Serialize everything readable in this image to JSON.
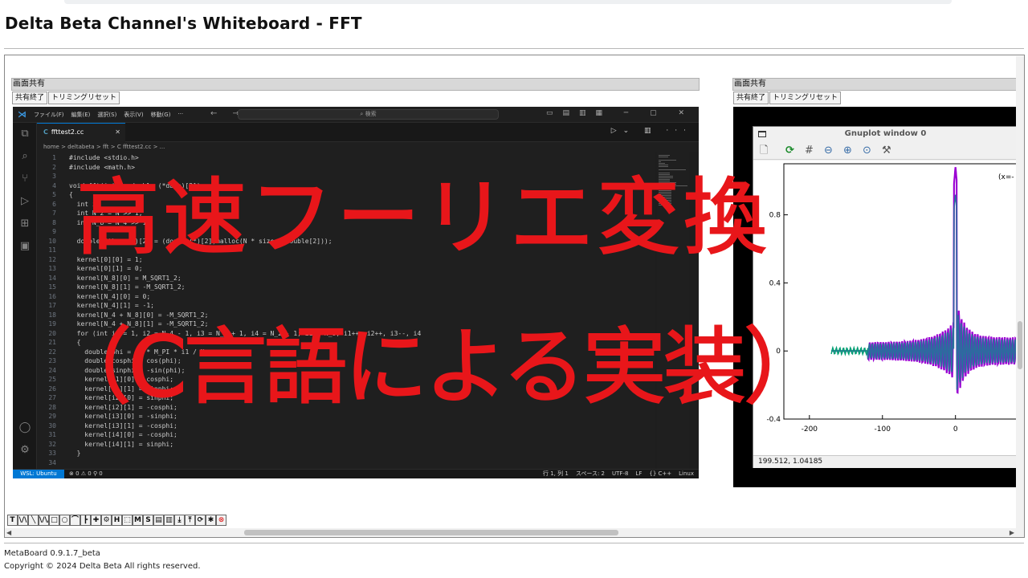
{
  "page": {
    "title": "Delta Beta Channel's Whiteboard - FFT"
  },
  "left_panel": {
    "header": "画面共有",
    "buttons": [
      "共有終了",
      "トリミングリセット"
    ]
  },
  "right_panel": {
    "header": "画面共有",
    "buttons": [
      "共有終了",
      "トリミングリセット"
    ]
  },
  "vscode": {
    "menu": [
      "ファイル(F)",
      "編集(E)",
      "選択(S)",
      "表示(V)",
      "移動(G)",
      "···"
    ],
    "nav": "← →",
    "search": "⌕ 検索",
    "tab": "ffttest2.cc",
    "tab_icon": "C",
    "breadcrumb": "home > deltabeta > fft > C ffttest2.cc > ...",
    "code_lines": [
      {
        "n": "1",
        "t": "#include <stdio.h>"
      },
      {
        "n": "2",
        "t": "#include <math.h>"
      },
      {
        "n": "3",
        "t": ""
      },
      {
        "n": "4",
        "t": "void fft(int N, double (*data)[2])"
      },
      {
        "n": "5",
        "t": "{"
      },
      {
        "n": "6",
        "t": "  int i;"
      },
      {
        "n": "7",
        "t": "  int N_2 = N >> 1;"
      },
      {
        "n": "8",
        "t": "  int N_8 = N_4 >> 1;"
      },
      {
        "n": "9",
        "t": ""
      },
      {
        "n": "10",
        "t": "  double (*kernel)[2] = (double(*)[2])malloc(N * sizeof(double[2]));"
      },
      {
        "n": "11",
        "t": ""
      },
      {
        "n": "12",
        "t": "  kernel[0][0] = 1;"
      },
      {
        "n": "13",
        "t": "  kernel[0][1] = 0;"
      },
      {
        "n": "14",
        "t": "  kernel[N_8][0] = M_SQRT1_2;"
      },
      {
        "n": "15",
        "t": "  kernel[N_8][1] = -M_SQRT1_2;"
      },
      {
        "n": "16",
        "t": "  kernel[N_4][0] = 0;"
      },
      {
        "n": "17",
        "t": "  kernel[N_4][1] = -1;"
      },
      {
        "n": "18",
        "t": "  kernel[N_4 + N_8][0] = -M_SQRT1_2;"
      },
      {
        "n": "19",
        "t": "  kernel[N_4 + N_8][1] = -M_SQRT1_2;"
      },
      {
        "n": "20",
        "t": "  for (int i1 = 1, i2 = N_4 - 1, i3 = N_4 + 1, i4 = N_2 - 1; i1 < N_8; i1++, i2++, i3--, i4"
      },
      {
        "n": "21",
        "t": "  {"
      },
      {
        "n": "22",
        "t": "    double phi = -2 * M_PI * i1 / N;"
      },
      {
        "n": "23",
        "t": "    double cosphi = cos(phi);"
      },
      {
        "n": "24",
        "t": "    double sinphi = -sin(phi);"
      },
      {
        "n": "25",
        "t": "    kernel[i1][0] = cosphi;"
      },
      {
        "n": "26",
        "t": "    kernel[i1][1] = sinphi;"
      },
      {
        "n": "27",
        "t": "    kernel[i2][0] = sinphi;"
      },
      {
        "n": "28",
        "t": "    kernel[i2][1] = -cosphi;"
      },
      {
        "n": "29",
        "t": "    kernel[i3][0] = -sinphi;"
      },
      {
        "n": "30",
        "t": "    kernel[i3][1] = -cosphi;"
      },
      {
        "n": "31",
        "t": "    kernel[i4][0] = -cosphi;"
      },
      {
        "n": "32",
        "t": "    kernel[i4][1] = sinphi;"
      },
      {
        "n": "33",
        "t": "  }"
      },
      {
        "n": "34",
        "t": ""
      }
    ],
    "status": {
      "remote": "WSL: Ubuntu",
      "problems": "⊗ 0 ⚠ 0  ⚲ 0",
      "position": "行 1, 列 1",
      "spaces": "スペース: 2",
      "encoding": "UTF-8",
      "eol": "LF",
      "lang": "{} C++",
      "os": "Linux"
    }
  },
  "gnuplot": {
    "title": "Gnuplot window 0",
    "legend_partial": "(x=-",
    "status": "199.512, 1.04185"
  },
  "chart_data": {
    "type": "line",
    "title": "",
    "xlabel": "",
    "ylabel": "",
    "x_ticks": [
      "-200",
      "-100",
      "0"
    ],
    "y_ticks": [
      "0.8",
      "0.4",
      "0",
      "-0.4"
    ],
    "xlim": [
      -235,
      85
    ],
    "ylim": [
      -0.4,
      1.1
    ],
    "series": [
      {
        "color": "#9b00d3"
      },
      {
        "color": "#2a6e9e"
      },
      {
        "color": "#009e73"
      }
    ]
  },
  "overlay": {
    "line1": "高速フーリエ変換",
    "line2": "（C言語による実装）",
    "color": "#e8161a"
  },
  "toolbar": {
    "tools": [
      "T",
      "\\/\\",
      "╲",
      "\\/\\/",
      "□",
      "○",
      "⌒",
      "┣",
      "✚",
      "⚙",
      "H",
      "⬚",
      "M",
      "S",
      "▤",
      "▥",
      "⤓",
      "⤒",
      "⟳",
      "✱",
      "⊗"
    ]
  },
  "footer": {
    "version": "MetaBoard 0.9.1.7_beta",
    "copyright": "Copyright © 2024 Delta Beta All rights reserved."
  }
}
